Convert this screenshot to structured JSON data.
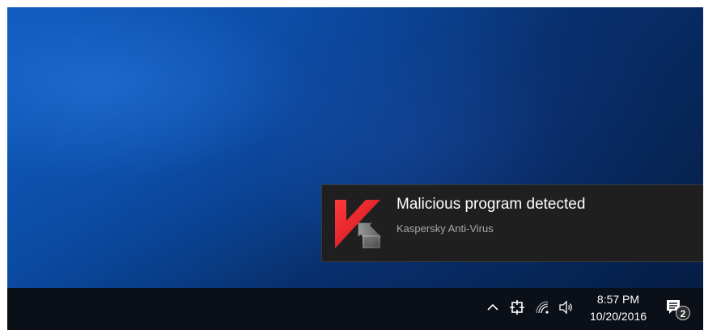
{
  "notification": {
    "title": "Malicious program detected",
    "source": "Kaspersky Anti-Virus",
    "app_icon": "kaspersky-logo-icon",
    "background_color": "#1f1f1f",
    "accent_colors": [
      "#e31e24",
      "#7a7a7a"
    ]
  },
  "taskbar": {
    "background_color": "#0b0f17",
    "tray_icons": [
      "chevron-up-icon",
      "network-settings-icon",
      "wifi-icon",
      "volume-icon"
    ],
    "clock": {
      "time": "8:57 PM",
      "date": "10/20/2016"
    },
    "action_center": {
      "icon": "action-center-icon",
      "badge_count": "2"
    }
  }
}
